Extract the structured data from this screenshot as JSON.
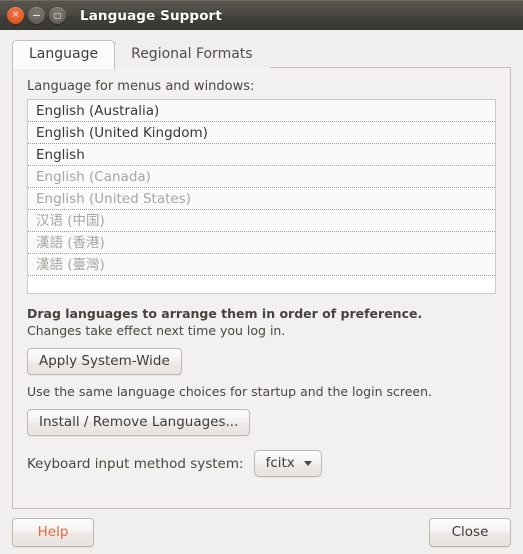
{
  "window": {
    "title": "Language Support",
    "controls": [
      {
        "name": "close",
        "glyph": "×"
      },
      {
        "name": "minimize",
        "glyph": "−"
      },
      {
        "name": "maximize",
        "glyph": "□"
      }
    ]
  },
  "tabs": [
    {
      "label": "Language",
      "active": true
    },
    {
      "label": "Regional Formats",
      "active": false
    }
  ],
  "language_tab": {
    "list_label": "Language for menus and windows:",
    "languages": [
      {
        "label": "English (Australia)",
        "enabled": true
      },
      {
        "label": "English (United Kingdom)",
        "enabled": true
      },
      {
        "label": "English",
        "enabled": true
      },
      {
        "label": "English (Canada)",
        "enabled": false
      },
      {
        "label": "English (United States)",
        "enabled": false
      },
      {
        "label": "汉语 (中国)",
        "enabled": false
      },
      {
        "label": "漢語 (香港)",
        "enabled": false
      },
      {
        "label": "漢語 (臺灣)",
        "enabled": false
      }
    ],
    "drag_hint": "Drag languages to arrange them in order of preference.",
    "changes_hint": "Changes take effect next time you log in.",
    "apply_button": "Apply System-Wide",
    "apply_hint": "Use the same language choices for startup and the login screen.",
    "install_button": "Install / Remove Languages...",
    "keyboard_label": "Keyboard input method system:",
    "keyboard_value": "fcitx"
  },
  "footer": {
    "help_label": "Help",
    "close_label": "Close"
  },
  "colors": {
    "accent_orange": "#e8693c",
    "titlebar_dark": "#4b4943",
    "enabled_text": "#3a3733",
    "disabled_text": "#a9a5a0"
  }
}
